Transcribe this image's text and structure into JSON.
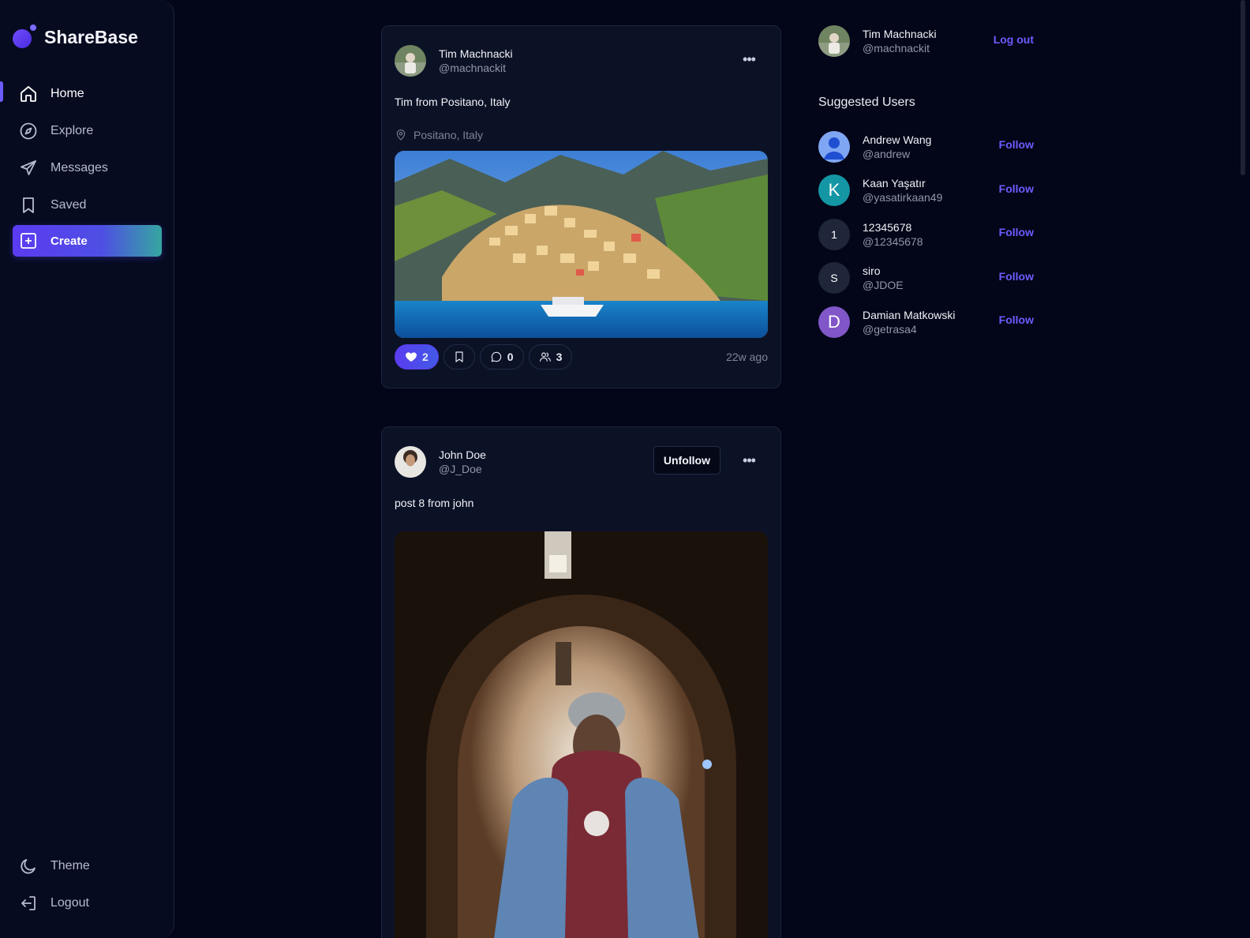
{
  "brand": {
    "name": "ShareBase"
  },
  "sidebar": {
    "items": [
      {
        "label": "Home",
        "icon": "home-icon",
        "active": true
      },
      {
        "label": "Explore",
        "icon": "compass-icon",
        "active": false
      },
      {
        "label": "Messages",
        "icon": "send-icon",
        "active": false
      },
      {
        "label": "Saved",
        "icon": "bookmark-icon",
        "active": false
      }
    ],
    "create_label": "Create",
    "bottom": [
      {
        "label": "Theme",
        "icon": "moon-icon"
      },
      {
        "label": "Logout",
        "icon": "logout-icon"
      }
    ]
  },
  "posts": [
    {
      "name": "Tim Machnacki",
      "handle": "@machnackit",
      "text": "Tim from Positano, Italy",
      "location": "Positano, Italy",
      "likes": "2",
      "comments": "0",
      "shares": "3",
      "time": "22w ago"
    },
    {
      "name": "John Doe",
      "handle": "@J_Doe",
      "text": "post 8 from john",
      "unfollow_label": "Unfollow"
    }
  ],
  "current_user": {
    "name": "Tim Machnacki",
    "handle": "@machnackit",
    "logout_label": "Log out"
  },
  "suggested": {
    "title": "Suggested Users",
    "follow_label": "Follow",
    "users": [
      {
        "name": "Andrew Wang",
        "handle": "@andrew",
        "initial": "",
        "color": "#7fa6f3"
      },
      {
        "name": "Kaan Yaşatır",
        "handle": "@yasatirkaan49",
        "initial": "K",
        "color": "#1496a5"
      },
      {
        "name": "12345678",
        "handle": "@12345678",
        "initial": "1",
        "color": "#1f2639"
      },
      {
        "name": "siro",
        "handle": "@JDOE",
        "initial": "S",
        "color": "#1f2639"
      },
      {
        "name": "Damian Matkowski",
        "handle": "@getrasa4",
        "initial": "D",
        "color": "#8156c9"
      }
    ]
  },
  "colors": {
    "accent": "#6b5cff",
    "background": "#030618",
    "card": "#0c1226"
  }
}
